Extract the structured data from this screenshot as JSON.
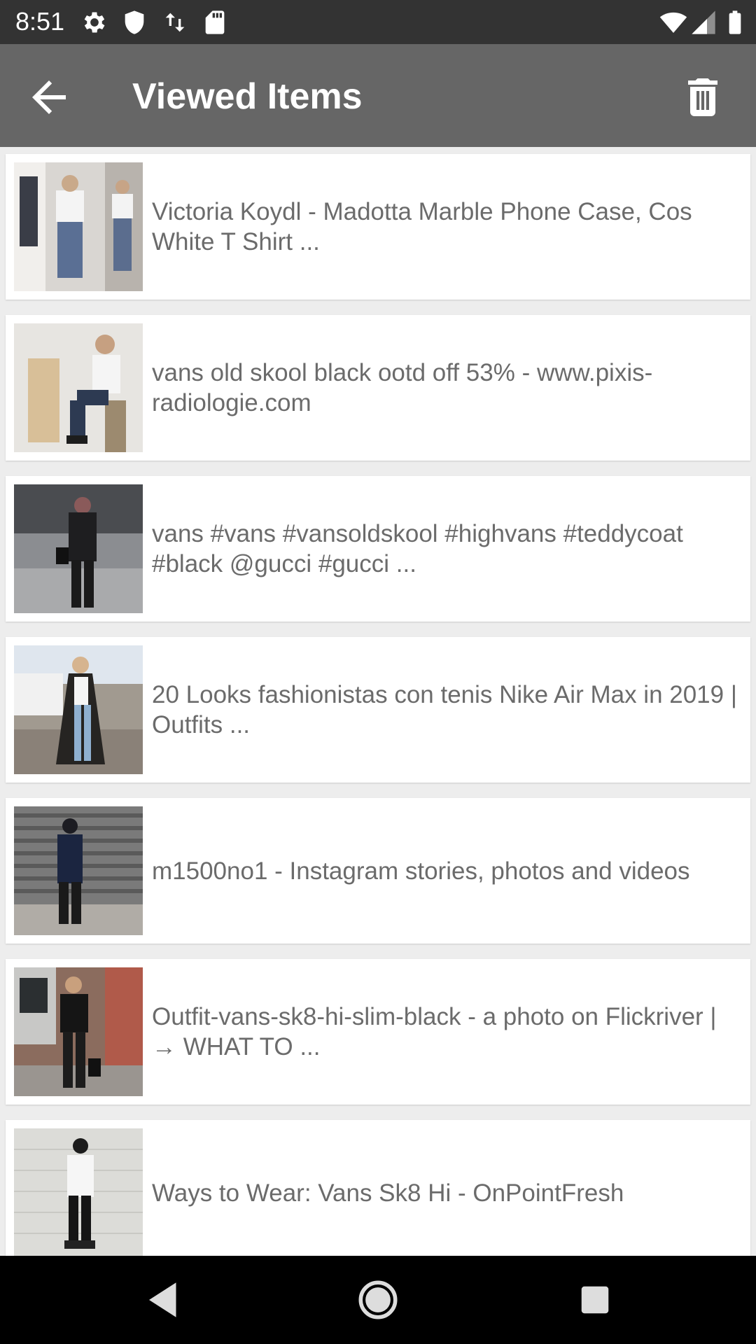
{
  "status_bar": {
    "time": "8:51",
    "left_icons": [
      "gear-icon",
      "shield-icon",
      "data-transfer-icon",
      "sd-card-icon"
    ],
    "right_icons": [
      "wifi-icon",
      "cell-signal-icon",
      "battery-icon"
    ]
  },
  "app_bar": {
    "title": "Viewed Items",
    "back_icon": "arrow-back-icon",
    "delete_icon": "trash-icon",
    "color": "#666666"
  },
  "items": [
    {
      "text": "Victoria Koydl - Madotta Marble Phone Case, Cos White T Shirt ..."
    },
    {
      "text": "vans old skool black ootd off 53% - www.pixis-radiologie.com"
    },
    {
      "text": "vans #vans #vansoldskool #highvans #teddycoat #black @gucci #gucci ..."
    },
    {
      "text": "20 Looks fashionistas con tenis Nike Air Max in 2019 | Outfits ..."
    },
    {
      "text": "m1500no1 - Instagram stories, photos and videos"
    },
    {
      "text": "Outfit-vans-sk8-hi-slim-black - a photo on Flickriver | → WHAT TO ..."
    },
    {
      "text": "Ways to Wear: Vans Sk8 Hi - OnPointFresh"
    }
  ],
  "nav_bar": {
    "back_icon": "nav-back-icon",
    "home_icon": "nav-home-icon",
    "recents_icon": "nav-recents-icon"
  }
}
